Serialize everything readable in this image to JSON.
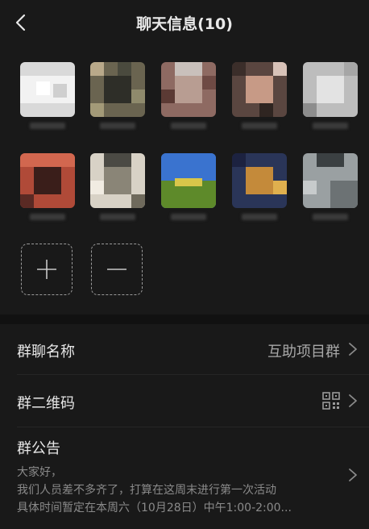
{
  "header": {
    "title": "聊天信息(10)",
    "back_icon": "chevron-left-icon"
  },
  "members": {
    "count_shown": 10,
    "add_icon": "plus-icon",
    "remove_icon": "minus-icon"
  },
  "settings": {
    "group_name_label": "群聊名称",
    "group_name_value": "互助项目群",
    "qr_label": "群二维码",
    "qr_icon": "qr-code-icon",
    "announcement_label": "群公告",
    "announcement_lines": [
      "大家好，",
      "我们人员差不多齐了，打算在这周末进行第一次活动",
      "具体时间暂定在本周六（10月28日）中午1:00-2:00..."
    ]
  },
  "colors": {
    "background": "#191919",
    "divider": "#111111",
    "text_primary": "#e6e6e6",
    "text_secondary": "#8a8a8a"
  }
}
